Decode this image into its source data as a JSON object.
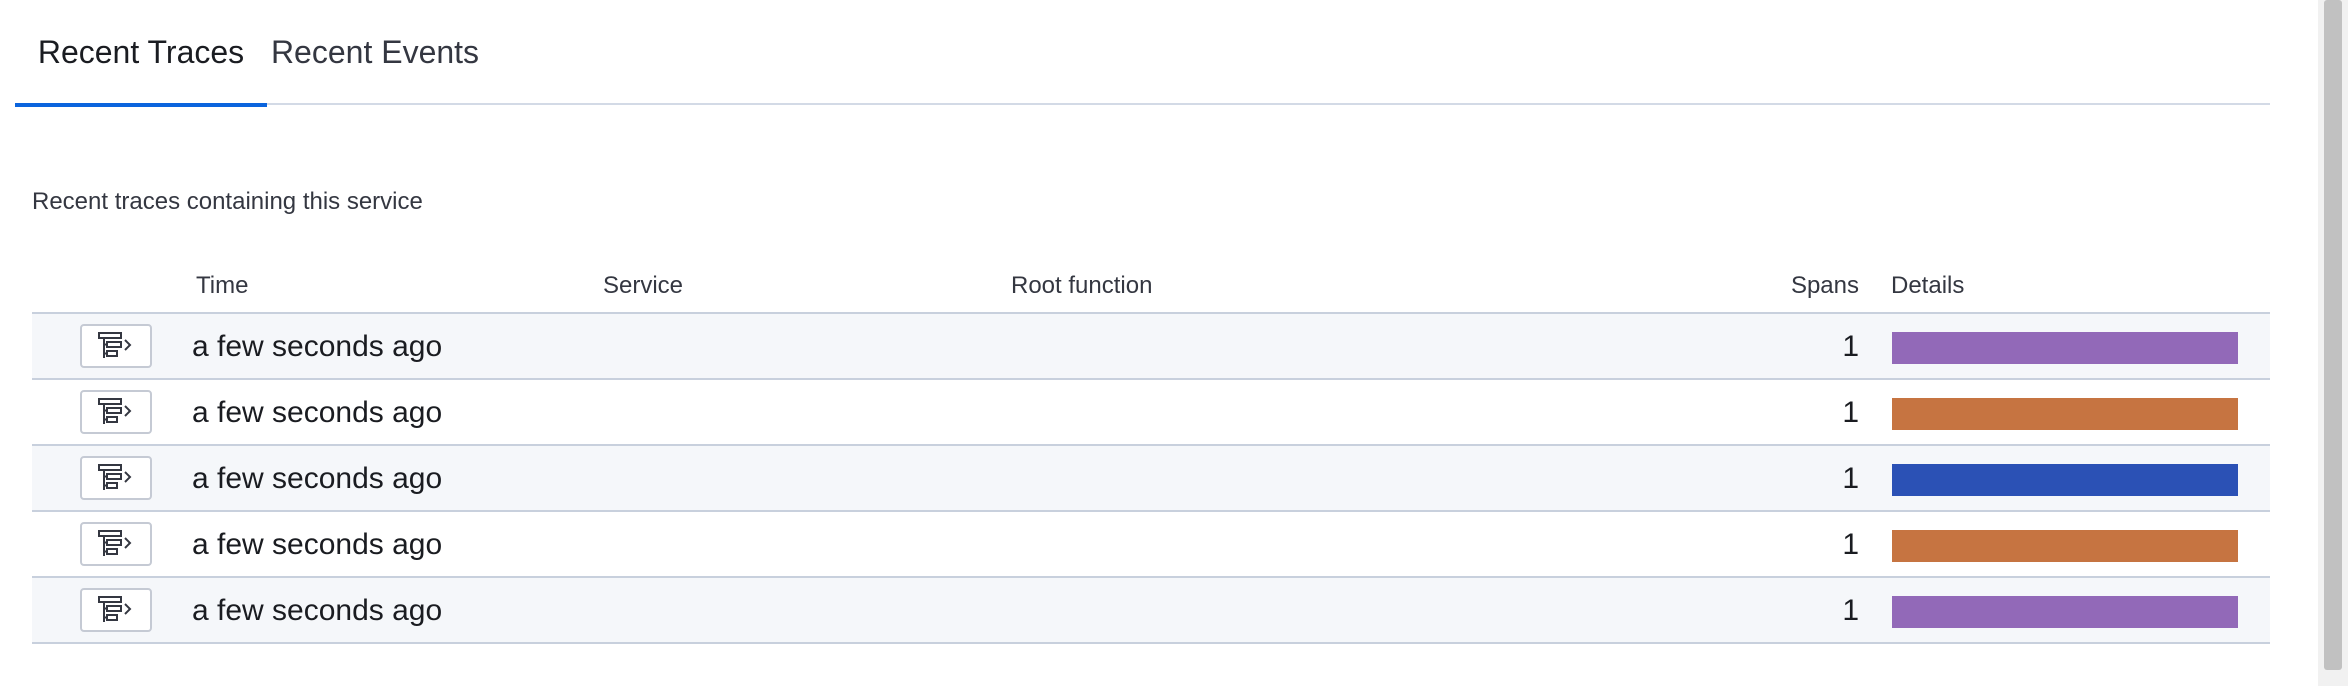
{
  "tabs": [
    {
      "label": "Recent Traces",
      "selected": true
    },
    {
      "label": "Recent Events",
      "selected": false
    }
  ],
  "description": "Recent traces containing this service",
  "table": {
    "columns": {
      "time": "Time",
      "service": "Service",
      "root_function": "Root function",
      "spans": "Spans",
      "details": "Details"
    },
    "rows": [
      {
        "time": "a few seconds ago",
        "service": "",
        "root_function": "",
        "spans": "1",
        "details_color": "#9269b8"
      },
      {
        "time": "a few seconds ago",
        "service": "",
        "root_function": "",
        "spans": "1",
        "details_color": "#c67441"
      },
      {
        "time": "a few seconds ago",
        "service": "",
        "root_function": "",
        "spans": "1",
        "details_color": "#2b51b5"
      },
      {
        "time": "a few seconds ago",
        "service": "",
        "root_function": "",
        "spans": "1",
        "details_color": "#c67441"
      },
      {
        "time": "a few seconds ago",
        "service": "",
        "root_function": "",
        "spans": "1",
        "details_color": "#9269b8"
      }
    ]
  },
  "icons": {
    "row_action": "trace-waterfall-icon"
  },
  "colors": {
    "accent": "#0b64dd",
    "border": "#d3dae6",
    "row_stripe": "#f5f7fa"
  }
}
